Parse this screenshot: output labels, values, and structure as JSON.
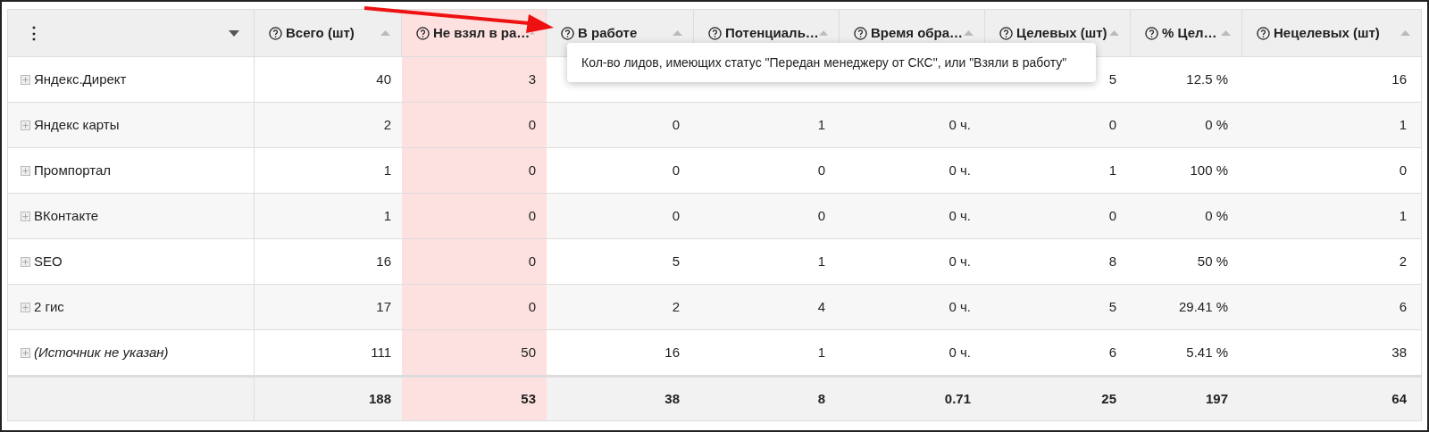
{
  "table": {
    "columns": [
      {
        "label": "⋮",
        "kind": "menu"
      },
      {
        "label": "Всего (шт)",
        "kind": "metric",
        "highlighted": false
      },
      {
        "label": "Не взял в ра…",
        "kind": "metric",
        "highlighted": true
      },
      {
        "label": "В работе",
        "kind": "metric",
        "highlighted": false
      },
      {
        "label": "Потенциаль…",
        "kind": "metric",
        "highlighted": false
      },
      {
        "label": "Время обра…",
        "kind": "metric",
        "highlighted": false
      },
      {
        "label": "Целевых (шт)",
        "kind": "metric",
        "highlighted": false
      },
      {
        "label": "% Цел…",
        "kind": "metric",
        "highlighted": false
      },
      {
        "label": "Нецелевых (шт)",
        "kind": "metric",
        "highlighted": false
      }
    ],
    "rows": [
      {
        "italic": false,
        "cells": [
          "Яндекс.Директ",
          "40",
          "3",
          null,
          null,
          null,
          "5",
          "12.5 %",
          "16"
        ]
      },
      {
        "italic": false,
        "cells": [
          "Яндекс карты",
          "2",
          "0",
          "0",
          "1",
          "0 ч.",
          "0",
          "0 %",
          "1"
        ]
      },
      {
        "italic": false,
        "cells": [
          "Промпортал",
          "1",
          "0",
          "0",
          "0",
          "0 ч.",
          "1",
          "100 %",
          "0"
        ]
      },
      {
        "italic": false,
        "cells": [
          "ВКонтакте",
          "1",
          "0",
          "0",
          "0",
          "0 ч.",
          "0",
          "0 %",
          "1"
        ]
      },
      {
        "italic": false,
        "cells": [
          "SEO",
          "16",
          "0",
          "5",
          "1",
          "0 ч.",
          "8",
          "50 %",
          "2"
        ]
      },
      {
        "italic": false,
        "cells": [
          "2 гис",
          "17",
          "0",
          "2",
          "4",
          "0 ч.",
          "5",
          "29.41 %",
          "6"
        ]
      },
      {
        "italic": true,
        "cells": [
          "(Источник не указан)",
          "111",
          "50",
          "16",
          "1",
          "0 ч.",
          "6",
          "5.41 %",
          "38"
        ]
      }
    ],
    "totals": [
      "188",
      "53",
      "38",
      "8",
      "0.71",
      "25",
      "197",
      "64"
    ]
  },
  "tooltip": {
    "text": "Кол-во лидов, имеющих статус \"Передан менеджеру от СКС\", или \"Взяли в работу\""
  }
}
